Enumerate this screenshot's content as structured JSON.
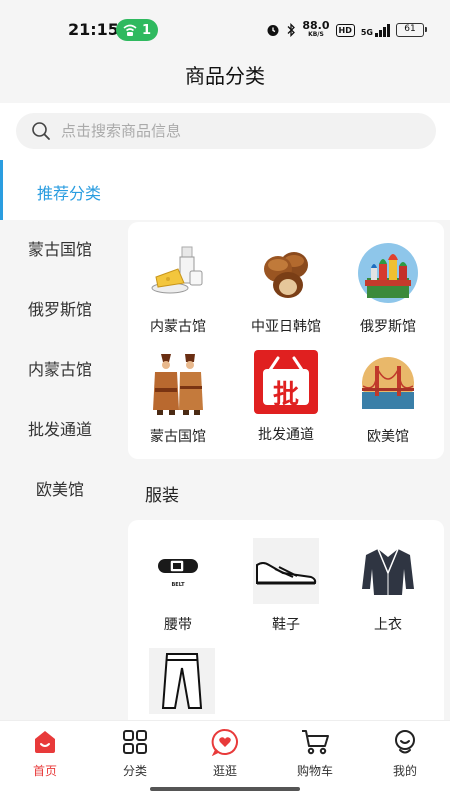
{
  "status": {
    "time": "21:15",
    "hotspot_count": "1",
    "speed_value": "88.0",
    "speed_unit": "KB/S",
    "hd": "HD",
    "network": "5G",
    "battery": "61"
  },
  "header": {
    "title": "商品分类"
  },
  "search": {
    "placeholder": "点击搜索商品信息"
  },
  "recommend_tab": {
    "label": "推荐分类"
  },
  "sidebar": {
    "items": [
      {
        "label": "蒙古国馆"
      },
      {
        "label": "俄罗斯馆"
      },
      {
        "label": "内蒙古馆"
      },
      {
        "label": "批发通道"
      },
      {
        "label": "欧美馆"
      }
    ]
  },
  "recommend_grid": {
    "items": [
      {
        "label": "内蒙古馆",
        "icon": "dairy-icon"
      },
      {
        "label": "中亚日韩馆",
        "icon": "hazelnut-icon"
      },
      {
        "label": "俄罗斯馆",
        "icon": "kremlin-icon"
      },
      {
        "label": "蒙古国馆",
        "icon": "mongolian-costume-icon"
      },
      {
        "label": "批发通道",
        "icon": "wholesale-basket-icon",
        "badge_char": "批",
        "badge_color": "#e02020"
      },
      {
        "label": "欧美馆",
        "icon": "golden-gate-bridge-icon"
      }
    ]
  },
  "clothing": {
    "title": "服装",
    "items": [
      {
        "label": "腰带",
        "icon": "belt-icon",
        "icon_text": "BELT"
      },
      {
        "label": "鞋子",
        "icon": "shoe-icon"
      },
      {
        "label": "上衣",
        "icon": "jacket-icon"
      },
      {
        "label": "",
        "icon": "pants-icon"
      }
    ]
  },
  "bottom_nav": {
    "items": [
      {
        "label": "首页",
        "icon": "home-icon",
        "active": true
      },
      {
        "label": "分类",
        "icon": "category-grid-icon",
        "active": false
      },
      {
        "label": "逛逛",
        "icon": "heart-bubble-icon",
        "active": false
      },
      {
        "label": "购物车",
        "icon": "cart-icon",
        "active": false
      },
      {
        "label": "我的",
        "icon": "profile-icon",
        "active": false
      }
    ]
  },
  "colors": {
    "accent_blue": "#2a9de0",
    "accent_red": "#e83a3a",
    "hotspot_green": "#2fb95f"
  }
}
